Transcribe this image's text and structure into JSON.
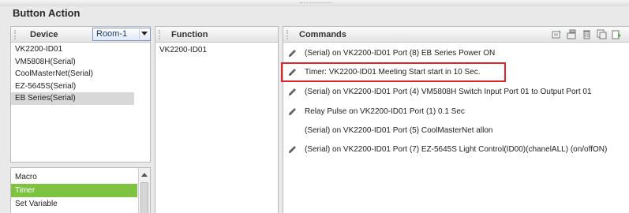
{
  "window": {
    "title": "Button Action"
  },
  "device_panel": {
    "header": "Device",
    "room_select": {
      "value": "Room-1"
    },
    "items": [
      {
        "label": "VK2200-ID01",
        "selected": false
      },
      {
        "label": "VM5808H(Serial)",
        "selected": false
      },
      {
        "label": "CoolMasterNet(Serial)",
        "selected": false
      },
      {
        "label": "EZ-5645S(Serial)",
        "selected": false
      },
      {
        "label": "EB Series(Serial)",
        "selected": true
      }
    ]
  },
  "macro_panel": {
    "items": [
      {
        "label": "Macro",
        "active": false
      },
      {
        "label": "Timer",
        "active": true
      },
      {
        "label": "Set Variable",
        "active": false
      }
    ]
  },
  "function_panel": {
    "header": "Function",
    "items": [
      {
        "label": "VK2200-ID01"
      }
    ]
  },
  "commands_panel": {
    "header": "Commands",
    "toolbar_icons": [
      "add-command-icon",
      "edit-command-icon",
      "delete-command-icon",
      "copy-command-icon",
      "run-command-icon"
    ],
    "rows": [
      {
        "text": "(Serial) on VK2200-ID01 Port (8) EB Series Power ON",
        "has_pencil": true,
        "highlighted": false
      },
      {
        "text": "Timer: VK2200-ID01 Meeting Start start in 10 Sec.",
        "has_pencil": true,
        "highlighted": true
      },
      {
        "text": "(Serial) on VK2200-ID01 Port (4) VM5808H Switch Input Port 01 to Output Port 01",
        "has_pencil": true,
        "highlighted": false
      },
      {
        "text": "Relay Pulse on VK2200-ID01 Port (1) 0.1 Sec",
        "has_pencil": true,
        "highlighted": false
      },
      {
        "text": "(Serial) on VK2200-ID01 Port (5) CoolMasterNet allon",
        "has_pencil": false,
        "highlighted": false
      },
      {
        "text": "(Serial) on VK2200-ID01 Port (7) EZ-5645S Light Control(ID00)(chanelALL) (on/offON)",
        "has_pencil": true,
        "highlighted": false
      }
    ]
  },
  "colors": {
    "timer_active": "#7dc241",
    "highlight_border": "#e0252a",
    "selected_row": "#d8d8d8"
  }
}
